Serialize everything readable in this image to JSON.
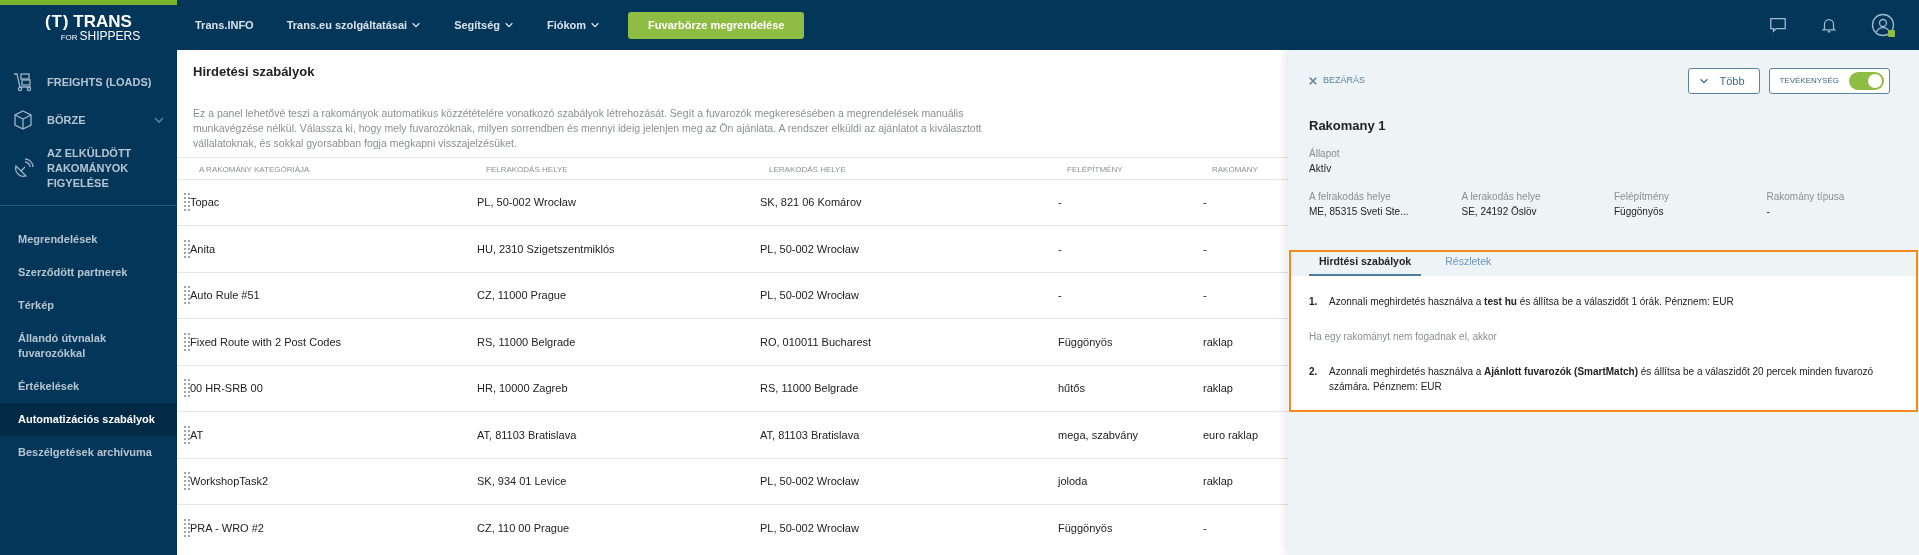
{
  "logo": {
    "mark": "(T)",
    "brand": "TRANS",
    "sub_for": "FOR",
    "sub": "SHIPPERS"
  },
  "sidebar": {
    "main_items": [
      {
        "label": "FREIGHTS (LOADS)",
        "expandable": false
      },
      {
        "label": "BÖRZE",
        "expandable": true
      },
      {
        "label": "AZ ELKÜLDÖTT RAKOMÁNYOK FIGYELÉSE",
        "expandable": false
      }
    ],
    "items": [
      {
        "label": "Megrendelések",
        "selected": false
      },
      {
        "label": "Szerződött partnerek",
        "selected": false
      },
      {
        "label": "Térkép",
        "selected": false
      },
      {
        "label": "Állandó útvnalak fuvarozókkal",
        "selected": false
      },
      {
        "label": "Értékelések",
        "selected": false
      },
      {
        "label": "Automatizációs szabályok",
        "selected": true
      },
      {
        "label": "Beszélgetések archívuma",
        "selected": false
      }
    ]
  },
  "top_nav": {
    "items": [
      {
        "label": "Trans.INFO",
        "dropdown": false
      },
      {
        "label": "Trans.eu szolgáltatásai",
        "dropdown": true
      },
      {
        "label": "Segítség",
        "dropdown": true
      },
      {
        "label": "Fiókom",
        "dropdown": true
      }
    ],
    "cta": "Fuvarbörze megrendelése",
    "user_online": true
  },
  "page": {
    "title": "Hirdetési szabályok",
    "description": "Ez a panel lehetővé teszi a rakományok automatikus közzétételére vonatkozó szabályok létrehozását. Segít a fuvarozók megkeresésében a megrendelések manuális munkavégzése nélkül. Válassza ki, hogy mely fuvarozóknak, milyen sorrendben és mennyi ideig jelenjen meg az Ön ajánlata. A rendszer elküldi az ajánlatot a kiválasztott vállalatoknak, és sokkal gyorsabban fogja megkapni visszajelzésüket."
  },
  "table": {
    "columns": [
      "A RAKOMÁNY KATEGÓRIÁJA",
      "FELRAKODÁS HELYE",
      "LERAKODÁS HELYE",
      "FELÉPÍTMÉNY",
      "RAKOMÁNY"
    ],
    "rows": [
      [
        "Topac",
        "PL, 50-002 Wrocław",
        "SK, 821 06 Komárov",
        "-",
        "-"
      ],
      [
        "Anita",
        "HU, 2310 Szigetszentmiklós",
        "PL, 50-002 Wrocław",
        "-",
        "-"
      ],
      [
        "Auto Rule #51",
        "CZ, 11000 Prague",
        "PL, 50-002 Wrocław",
        "-",
        "-"
      ],
      [
        "Fixed Route with 2 Post Codes",
        "RS, 11000 Belgrade",
        "RO, 010011 Bucharest",
        "Függönyös",
        "raklap"
      ],
      [
        "00 HR-SRB 00",
        "HR, 10000 Zagreb",
        "RS, 11000 Belgrade",
        "hűtős",
        "raklap"
      ],
      [
        "AT",
        "AT, 81103 Bratislava",
        "AT, 81103 Bratislava",
        "mega, szabvány",
        "euro raklap"
      ],
      [
        "WorkshopTask2",
        "SK, 934 01 Levice",
        "PL, 50-002 Wrocław",
        "joloda",
        "raklap"
      ],
      [
        "PRA - WRO #2",
        "CZ, 110 00 Prague",
        "PL, 50-002 Wrocław",
        "Függönyös",
        "-"
      ]
    ]
  },
  "panel": {
    "close": "BEZÁRÁS",
    "more": "Több",
    "activity": {
      "label": "TEVÉKENYSÉG",
      "on": true
    },
    "title": "Rakomany 1",
    "status": {
      "label": "Állapot",
      "value": "Aktív"
    },
    "fields": [
      {
        "label": "A felrakodás helye",
        "value": "ME, 85315 Sveti Ste..."
      },
      {
        "label": "A lerakodás helye",
        "value": "SE, 24192 Öslöv"
      },
      {
        "label": "Felépítmény",
        "value": "Függönyös"
      },
      {
        "label": "Rakomány típusa",
        "value": "-"
      }
    ],
    "tabs": [
      {
        "label": "Hirdtési szabályok",
        "selected": true
      },
      {
        "label": "Részletek",
        "selected": false
      }
    ],
    "rules": [
      {
        "kind": "step",
        "number": "1.",
        "text": "Azonnali meghirdetés használva a **test hu** és állítsa be a válaszidőt 1 órák. Pénznem: EUR"
      },
      {
        "kind": "note",
        "text": "Ha egy rakományt nem fogadnak el, akkor"
      },
      {
        "kind": "step",
        "number": "2.",
        "text": "Azonnali meghirdetés használva a **Ajánlott fuvarozók (SmartMatch)** és állítsa be a válaszidőt 20 percek minden fuvarozó számára. Pénznem: EUR"
      }
    ]
  }
}
